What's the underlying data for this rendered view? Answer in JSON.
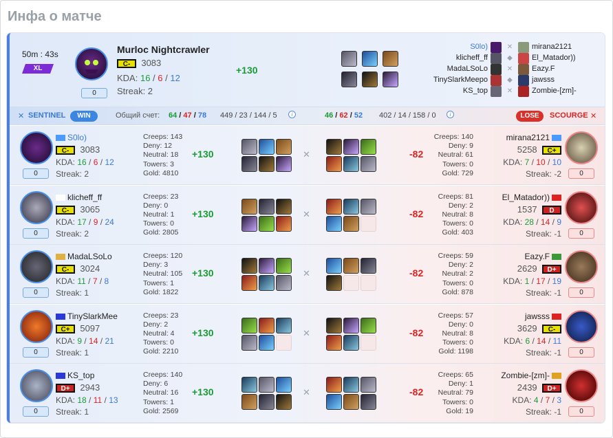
{
  "page_title": "Инфа о матче",
  "summary": {
    "duration": "50m : 43s",
    "mode_badge": "XL",
    "mvp_name": "Murloc Nightcrawler",
    "mvp_rank": "C-",
    "mvp_rating": "3083",
    "kda_label": "KDA:",
    "mvp_kills": "16",
    "mvp_deaths": "6",
    "mvp_assists": "12",
    "streak": "Streak: 2",
    "delta": "+130",
    "zero": "0",
    "roster_left": [
      "S0lo)",
      "klicheff_ff",
      "MadaLSoLo",
      "TinySlarkMeepo",
      "KS_top"
    ],
    "roster_right": [
      "mirana2121",
      "El_Matador))",
      "Eazy.F",
      "jawsss",
      "Zombie-[zm]-"
    ]
  },
  "scorebar": {
    "sentinel": "SENTINEL",
    "win": "WIN",
    "total_label": "Общий счет:",
    "s_kills": "64",
    "s_deaths": "47",
    "s_assists": "78",
    "s_creeps": "449 / 23 / 144 / 5",
    "sc_kills": "46",
    "sc_deaths": "62",
    "sc_assists": "52",
    "sc_creeps": "402 / 14 / 158 / 0",
    "lose": "LOSE",
    "scourge": "SCOURGE"
  },
  "players": [
    {
      "left": {
        "name": "S0lo)",
        "rank": "C-",
        "rating": "3083",
        "k": "16",
        "d": "6",
        "a": "12",
        "streak": "Streak: 2",
        "delta": "+130",
        "stats": [
          "Creeps: 143",
          "Deny: 12",
          "Neutral: 18",
          "Towers: 3",
          "Gold: 4810"
        ]
      },
      "right": {
        "name": "mirana2121",
        "rank": "C+",
        "rating": "5258",
        "k": "7",
        "d": "10",
        "a": "10",
        "streak": "Streak: -2",
        "delta": "-82",
        "stats": [
          "Creeps: 140",
          "Deny: 9",
          "Neutral: 61",
          "Towers: 0",
          "Gold: 729"
        ]
      }
    },
    {
      "left": {
        "name": "klicheff_ff",
        "rank": "C-",
        "rating": "3065",
        "k": "17",
        "d": "9",
        "a": "24",
        "streak": "Streak: 2",
        "delta": "+130",
        "stats": [
          "Creeps: 23",
          "Deny: 0",
          "Neutral: 1",
          "Towers: 0",
          "Gold: 2805"
        ]
      },
      "right": {
        "name": "El_Matador))",
        "rank": "D",
        "rating": "1537",
        "k": "28",
        "d": "14",
        "a": "9",
        "streak": "Streak: -1",
        "delta": "-82",
        "stats": [
          "Creeps: 81",
          "Deny: 2",
          "Neutral: 8",
          "Towers: 0",
          "Gold: 403"
        ]
      }
    },
    {
      "left": {
        "name": "MadaLSoLo",
        "rank": "C-",
        "rating": "3024",
        "k": "11",
        "d": "7",
        "a": "8",
        "streak": "Streak: 1",
        "delta": "+130",
        "stats": [
          "Creeps: 120",
          "Deny: 3",
          "Neutral: 105",
          "Towers: 1",
          "Gold: 1822"
        ]
      },
      "right": {
        "name": "Eazy.F",
        "rank": "D+",
        "rating": "2629",
        "k": "1",
        "d": "17",
        "a": "19",
        "streak": "Streak: -1",
        "delta": "-82",
        "stats": [
          "Creeps: 59",
          "Deny: 2",
          "Neutral: 2",
          "Towers: 0",
          "Gold: 878"
        ]
      }
    },
    {
      "left": {
        "name": "TinySlarkMee",
        "rank": "C+",
        "rating": "5097",
        "k": "9",
        "d": "14",
        "a": "21",
        "streak": "Streak: 1",
        "delta": "+130",
        "stats": [
          "Creeps: 23",
          "Deny: 2",
          "Neutral: 4",
          "Towers: 0",
          "Gold: 2210"
        ]
      },
      "right": {
        "name": "jawsss",
        "rank": "C-",
        "rating": "3629",
        "k": "6",
        "d": "14",
        "a": "11",
        "streak": "Streak: -1",
        "delta": "-82",
        "stats": [
          "Creeps: 57",
          "Deny: 0",
          "Neutral: 8",
          "Towers: 0",
          "Gold: 1198"
        ]
      }
    },
    {
      "left": {
        "name": "KS_top",
        "rank": "D+",
        "rating": "2943",
        "k": "18",
        "d": "11",
        "a": "13",
        "streak": "Streak: 1",
        "delta": "+130",
        "stats": [
          "Creeps: 140",
          "Deny: 6",
          "Neutral: 16",
          "Towers: 1",
          "Gold: 2569"
        ]
      },
      "right": {
        "name": "Zombie-[zm]-",
        "rank": "D+",
        "rating": "2439",
        "k": "4",
        "d": "7",
        "a": "3",
        "streak": "Streak: -1",
        "delta": "-82",
        "stats": [
          "Creeps: 65",
          "Deny: 1",
          "Neutral: 79",
          "Towers: 0",
          "Gold: 19"
        ]
      }
    }
  ],
  "colors": {
    "accent": "#4a7fe0",
    "win": "#3a86e0",
    "lose": "#d9302a",
    "positive": "#1a9b35",
    "negative": "#d22222"
  }
}
